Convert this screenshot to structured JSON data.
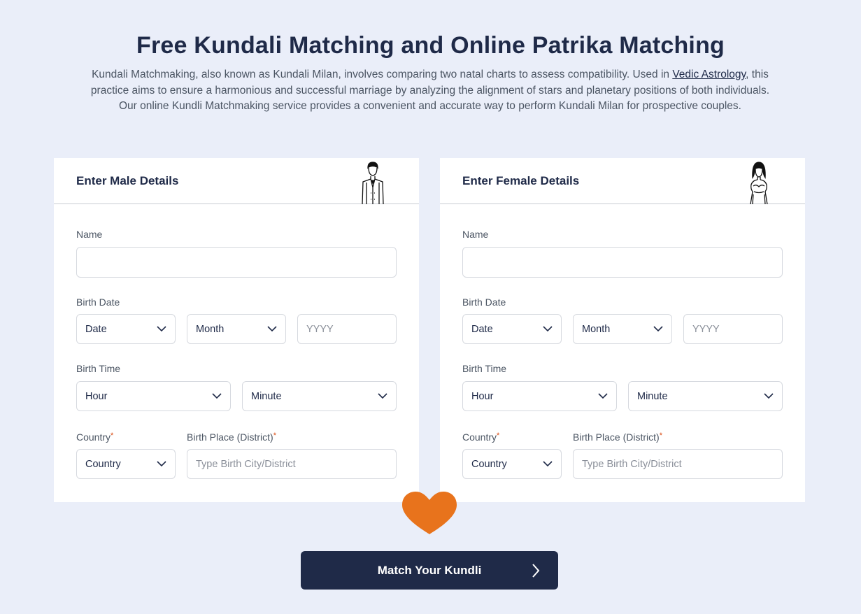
{
  "page": {
    "title": "Free Kundali Matching and Online Patrika Matching",
    "intro_before": "Kundali Matchmaking, also known as Kundali Milan, involves comparing two natal charts to assess compatibility. Used in ",
    "intro_link": "Vedic Astrology",
    "intro_after": ", this practice aims to ensure a harmonious and successful marriage by analyzing the alignment of stars and planetary positions of both individuals. Our online Kundli Matchmaking service provides a convenient and accurate way to perform Kundali Milan for prospective couples."
  },
  "male": {
    "heading": "Enter Male Details",
    "name_label": "Name",
    "name_value": "",
    "birth_date_label": "Birth Date",
    "date_select": "Date",
    "month_select": "Month",
    "year_placeholder": "YYYY",
    "birth_time_label": "Birth Time",
    "hour_select": "Hour",
    "minute_select": "Minute",
    "country_label": "Country",
    "country_select": "Country",
    "place_label": "Birth Place (District)",
    "place_placeholder": "Type Birth City/District"
  },
  "female": {
    "heading": "Enter Female Details",
    "name_label": "Name",
    "name_value": "",
    "birth_date_label": "Birth Date",
    "date_select": "Date",
    "month_select": "Month",
    "year_placeholder": "YYYY",
    "birth_time_label": "Birth Time",
    "hour_select": "Hour",
    "minute_select": "Minute",
    "country_label": "Country",
    "country_select": "Country",
    "place_label": "Birth Place (District)",
    "place_placeholder": "Type Birth City/District"
  },
  "required_mark": "*",
  "action": {
    "label": "Match Your Kundli"
  },
  "colors": {
    "background": "#eaeef9",
    "primary": "#1f2a48",
    "heart": "#e8731c",
    "required": "#d9480f"
  },
  "icons": {
    "male": "groom-icon",
    "female": "bride-icon",
    "dropdown": "chevron-down-icon",
    "heart": "heart-icon",
    "button_arrow": "chevron-right-icon"
  }
}
